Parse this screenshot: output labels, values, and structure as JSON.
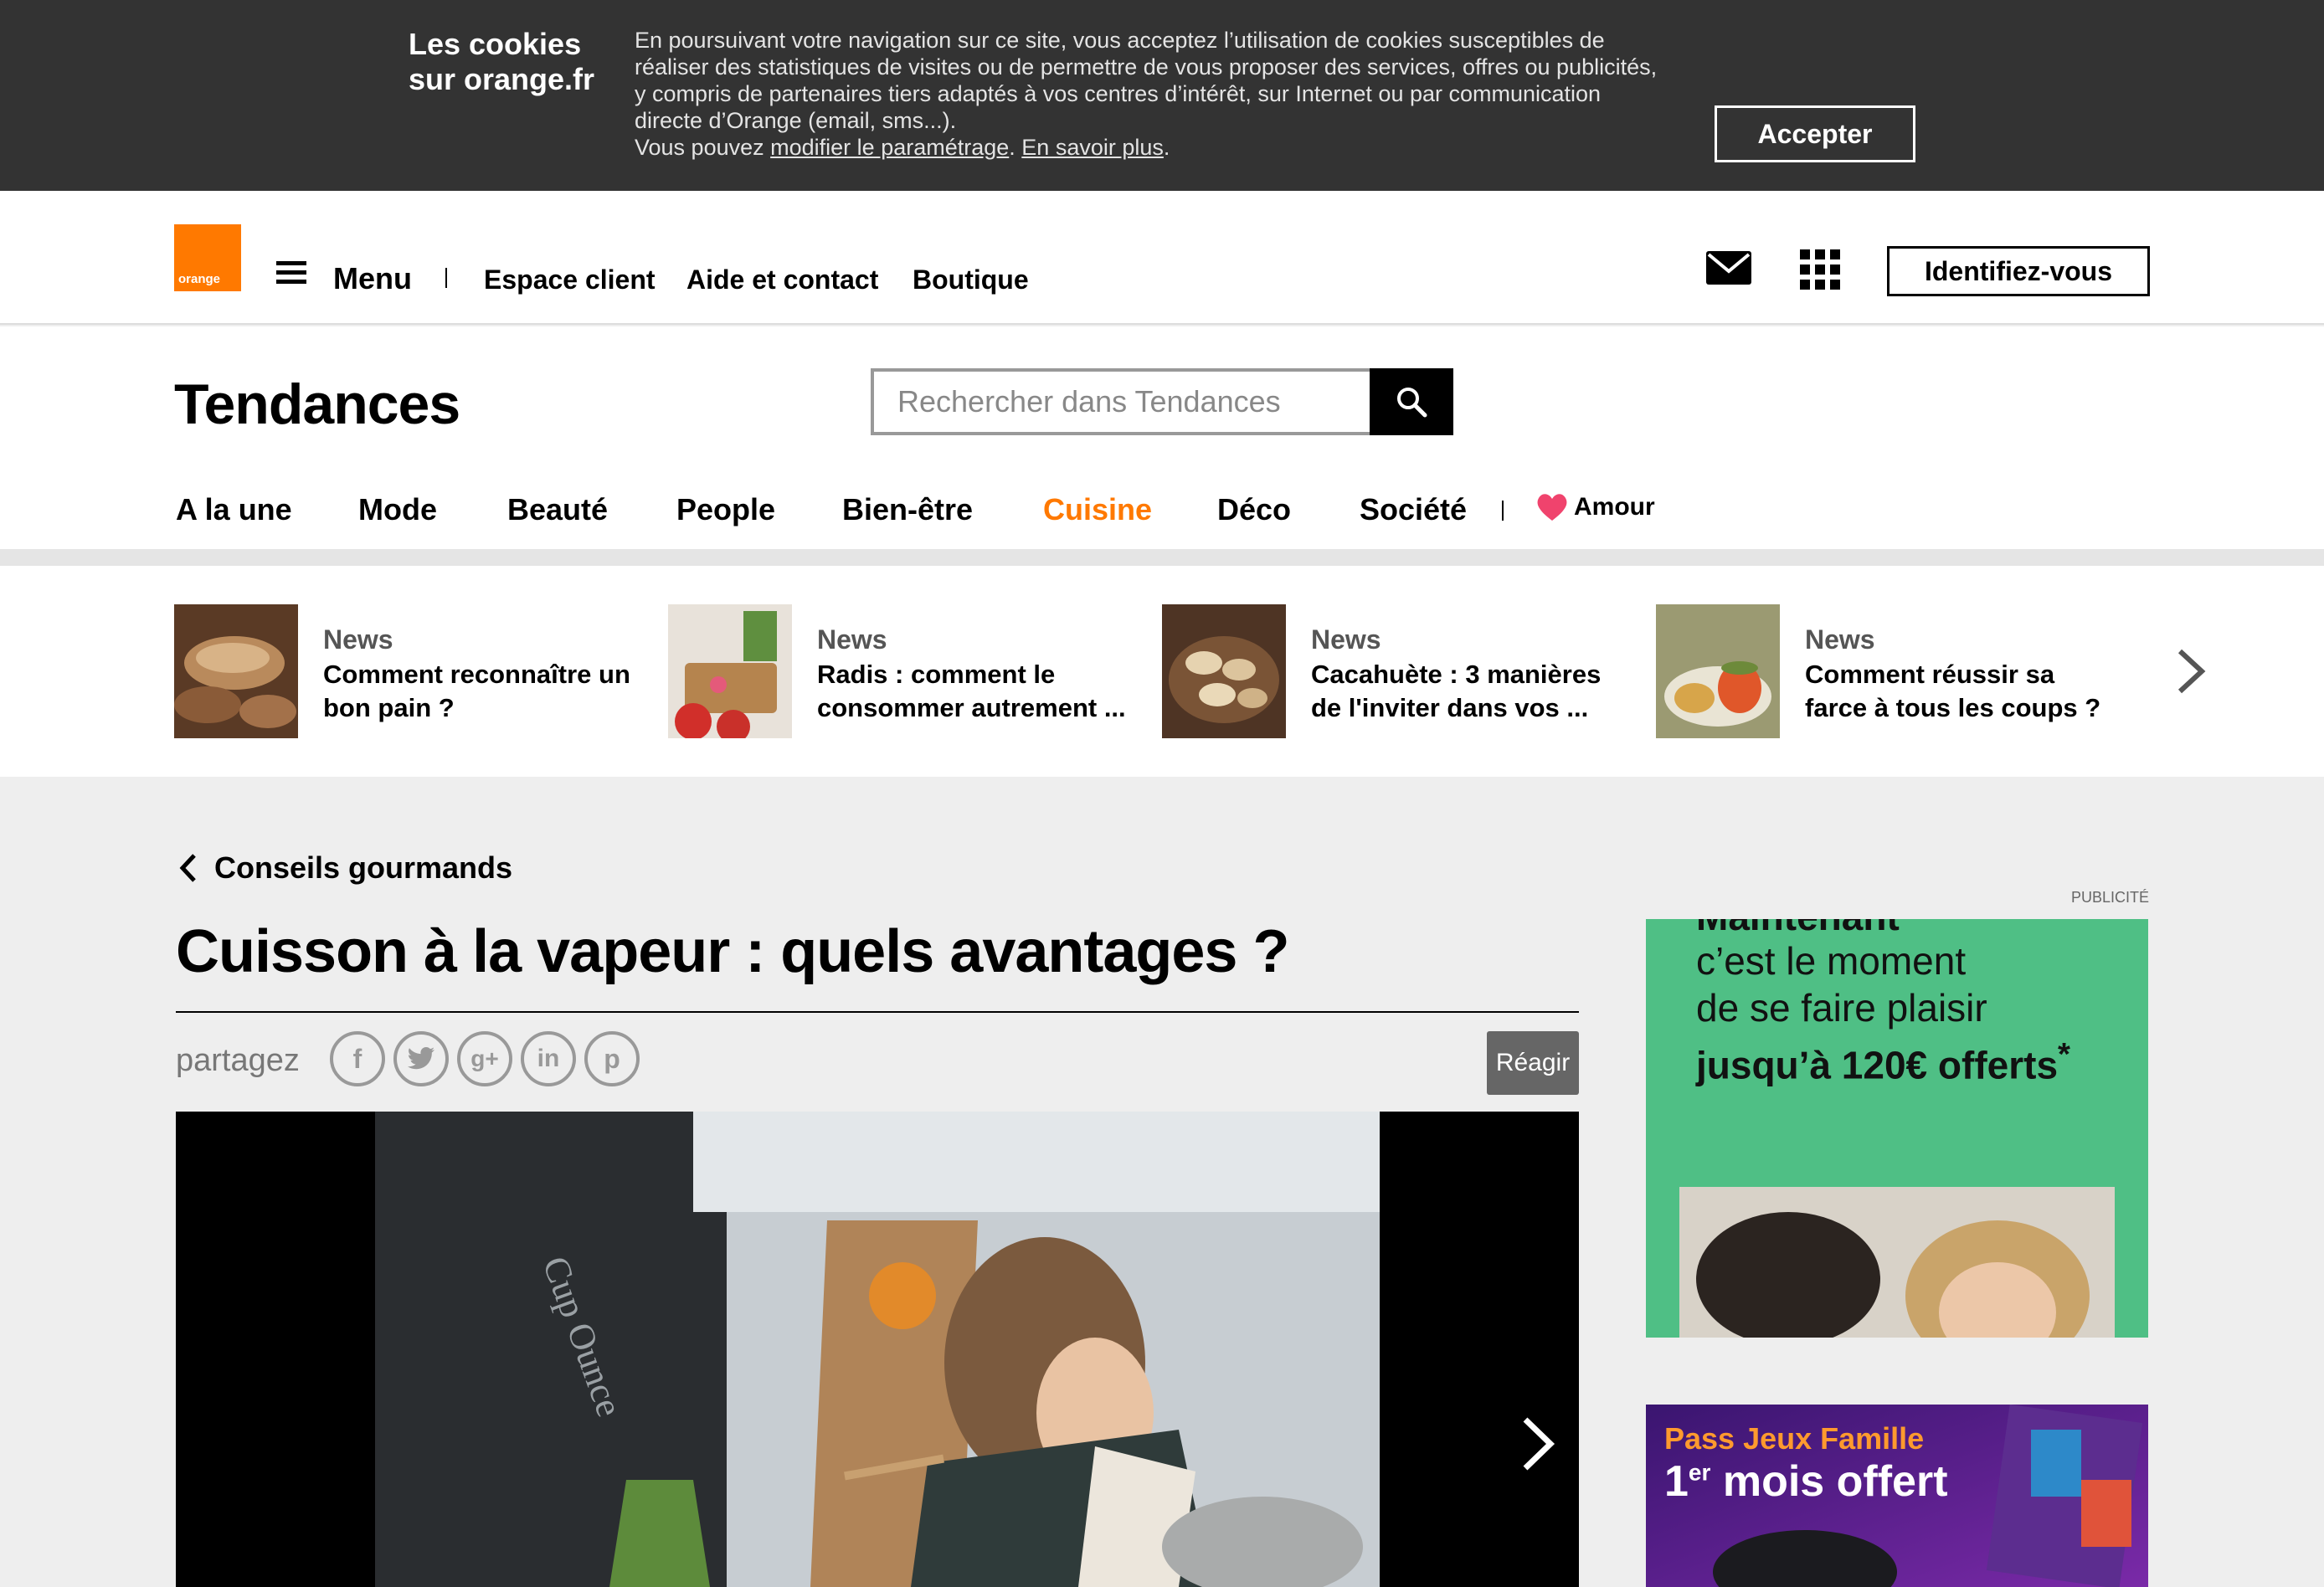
{
  "cookie": {
    "title_line1": "Les cookies",
    "title_line2": "sur orange.fr",
    "text": "En poursuivant votre navigation sur ce site, vous acceptez l’utilisation de cookies susceptibles de réaliser des statistiques de visites ou de permettre de vous proposer des services, offres ou publicités, y compris de partenaires tiers adaptés à vos centres d’intérêt, sur Internet ou par communication directe d’Orange (email, sms...).",
    "text2_prefix": "Vous pouvez",
    "link_settings": "modifier le paramétrage",
    "link_more": "En savoir plus",
    "accept_label": "Accepter"
  },
  "header": {
    "logo_text": "orange",
    "menu_label": "Menu",
    "links": [
      "Espace client",
      "Aide et contact",
      "Boutique"
    ],
    "identify_label": "Identifiez-vous"
  },
  "site": {
    "title": "Tendances",
    "search_placeholder": "Rechercher dans Tendances",
    "nav": [
      "A la une",
      "Mode",
      "Beauté",
      "People",
      "Bien-être",
      "Cuisine",
      "Déco",
      "Société"
    ],
    "active_nav": "Cuisine",
    "amour_label": "Amour",
    "accent_color": "#ff7900"
  },
  "news_strip": [
    {
      "category": "News",
      "title": "Comment reconnaître un bon pain ?"
    },
    {
      "category": "News",
      "title": "Radis : comment le consommer autrement ..."
    },
    {
      "category": "News",
      "title": "Cacahuète : 3 manières de l'inviter dans vos ..."
    },
    {
      "category": "News",
      "title": "Comment réussir sa farce à tous les coups ?"
    }
  ],
  "article": {
    "back_label": "Conseils gourmands",
    "headline": "Cuisson à la vapeur : quels avantages ?",
    "share_label": "partagez",
    "share_icons": [
      "facebook-icon",
      "twitter-icon",
      "google-plus-icon",
      "linkedin-icon",
      "pinterest-icon"
    ],
    "react_label": "Réagir"
  },
  "sidebar": {
    "pub_label": "PUBLICITÉ",
    "ad1": {
      "top": "Maintenant",
      "line1": "c’est le moment",
      "line2": "de se faire plaisir",
      "line3": "jusqu’à 120€ offerts",
      "star": "*",
      "bg_color": "#4fbf85"
    },
    "ad2": {
      "line1": "Pass Jeux Famille",
      "line2_a": "1",
      "line2_sup": "er",
      "line2_b": " mois offert"
    }
  }
}
